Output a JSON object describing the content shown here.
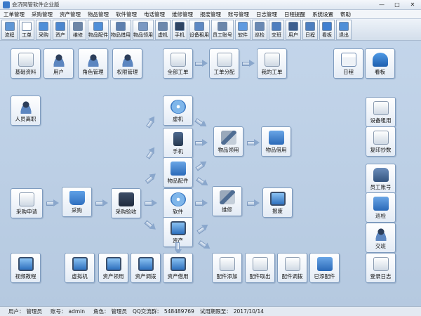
{
  "window": {
    "title": "会济网管软件企业版",
    "minimize": "—",
    "maximize": "□",
    "close": "✕"
  },
  "menu": [
    "工单管理",
    "采购管理",
    "资产管理",
    "物品管理",
    "软件管理",
    "电话管理",
    "维修管理",
    "报废管理",
    "账号管理",
    "日志管理",
    "日程提醒",
    "系统设置",
    "帮助"
  ],
  "toolbar": [
    {
      "label": "流程",
      "icon": "flow-icon",
      "color": "#5f97d6"
    },
    {
      "label": "工单",
      "icon": "document-icon",
      "color": "#ffffff"
    },
    {
      "label": "采购",
      "icon": "cart-icon",
      "color": "#4f8fd8"
    },
    {
      "label": "资产",
      "icon": "monitor-icon",
      "color": "#4c87cf"
    },
    {
      "label": "维修",
      "icon": "tools-icon",
      "color": "#6e86a6"
    },
    {
      "label": "物品配件",
      "icon": "network-icon",
      "color": "#4f8fd8"
    },
    {
      "label": "物品借用",
      "icon": "box-icon",
      "color": "#5d7fae"
    },
    {
      "label": "物品领用",
      "icon": "box-icon",
      "color": "#7a98c2"
    },
    {
      "label": "虚机",
      "icon": "server-icon",
      "color": "#6d88ac"
    },
    {
      "label": "手机",
      "icon": "phone-icon",
      "color": "#2e4463"
    },
    {
      "label": "设备租用",
      "icon": "device-icon",
      "color": "#5e89c3"
    },
    {
      "label": "员工账号",
      "icon": "id-card-icon",
      "color": "#6b86aa"
    },
    {
      "label": "软件",
      "icon": "cd-icon",
      "color": "#5f9ae0"
    },
    {
      "label": "巡检",
      "icon": "inspect-icon",
      "color": "#6a89b3"
    },
    {
      "label": "交班",
      "icon": "handover-icon",
      "color": "#4f7fbf"
    },
    {
      "label": "用户",
      "icon": "user-icon",
      "color": "#3e5f8e"
    },
    {
      "label": "日程",
      "icon": "calendar-icon",
      "color": "#4d7fc0"
    },
    {
      "label": "看板",
      "icon": "board-icon",
      "color": "#3f7fd0"
    },
    {
      "label": "退出",
      "icon": "exit-icon",
      "color": "#4f8fd8"
    }
  ],
  "nodes": {
    "basic_data": "基础资料",
    "users": "用户",
    "roles": "角色管理",
    "permissions": "权限管理",
    "all_tickets": "全部工单",
    "ticket_assign": "工单分配",
    "my_tickets": "我的工单",
    "schedule": "日程",
    "board": "看板",
    "staff_leave": "人员离职",
    "vm": "虚机",
    "phone": "手机",
    "item_parts": "物品配件",
    "item_receive": "物品领用",
    "item_borrow": "物品借用",
    "purchase_request": "采购申请",
    "purchase": "采购",
    "purchase_accept": "采购验收",
    "software": "软件",
    "repair": "维修",
    "scrap": "报废",
    "asset": "资产",
    "device_rent": "设备租用",
    "copy_count": "复印抄数",
    "staff_account": "员工账号",
    "inspection": "巡检",
    "handover": "交班",
    "login_log": "登录日志",
    "video_tutorial": "视频教程",
    "vm_bottom": "虚拟机",
    "asset_receive": "资产领用",
    "asset_transfer": "资产调拨",
    "asset_borrow": "资产借用",
    "part_add": "配件添加",
    "part_remove": "配件取出",
    "part_transfer": "配件调拨",
    "part_added": "已添配件"
  },
  "status": {
    "user_label": "用户：",
    "user_value": "管理员",
    "account_label": "账号：",
    "account_value": "admin",
    "role_label": "角色：",
    "role_value": "管理员",
    "qq_label": "QQ交流群：",
    "qq_value": "548489769",
    "expire_label": "试用期限至：",
    "expire_value": "2017/10/14"
  }
}
